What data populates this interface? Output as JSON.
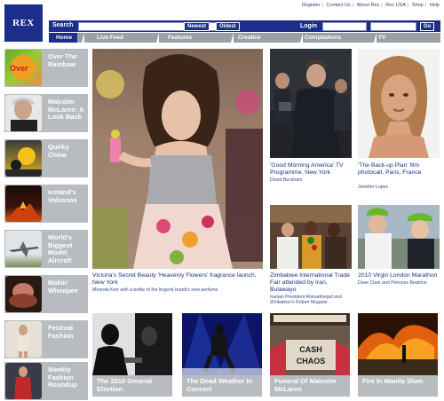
{
  "brand": {
    "logo_text": "REX",
    "accent": "#1c2e8a",
    "panel_grey": "#b8bcc0"
  },
  "top_links": [
    "Register",
    "Contact Us",
    "About Rex",
    "Rex USA",
    "Shop",
    "Help"
  ],
  "search": {
    "label": "Search",
    "newest": "Newest",
    "oldest": "Oldest",
    "login_label": "Login",
    "go": "Go"
  },
  "nav": [
    {
      "label": "Home",
      "active": true
    },
    {
      "label": "Live Feed"
    },
    {
      "label": "Features"
    },
    {
      "label": "Creative"
    },
    {
      "label": "Compilations"
    },
    {
      "label": "TV"
    }
  ],
  "sidebar": [
    {
      "label": "Over The Rainbow"
    },
    {
      "label": "Malcolm McLaren: A Look Back"
    },
    {
      "label": "Quirky China"
    },
    {
      "label": "Iceland's Volcanos"
    },
    {
      "label": "World's Biggest Model Aircraft"
    },
    {
      "label": "Makin' Whoopee"
    },
    {
      "label": "Festival Fashion"
    },
    {
      "label": "Weekly Fashion Roundup"
    }
  ],
  "feature": {
    "caption": "Victoria's Secret Beauty 'Heavenly Flowers' fragrance launch, New York",
    "sub": "Miranda Kerr with a bottle of the lingerie brand's new perfume"
  },
  "grid": [
    {
      "caption": "'Good Morning America' TV Programme, New York",
      "sub": "David Beckham"
    },
    {
      "caption": "'The Back-up Plan' film photocall, Paris, France",
      "sub": "Jennifer Lopez"
    },
    {
      "caption": "Zimbabwe International Trade Fair attended by Iran, Bulawayo",
      "sub": "Iranian President Ahmadinejad and Zimbabwe's Robert Mugabe"
    },
    {
      "caption": "2010 Virgin London Marathon",
      "sub": "Dave Clark and Princess Beatrice"
    }
  ],
  "bottom": [
    {
      "label": "The 2010 General Election"
    },
    {
      "label": "The Dead Weather In Concert"
    },
    {
      "label": "Funeral Of Malcolm McLaren",
      "sign_text": "CASH FROM CHAOS"
    },
    {
      "label": "Fire In Manila Slum"
    }
  ]
}
